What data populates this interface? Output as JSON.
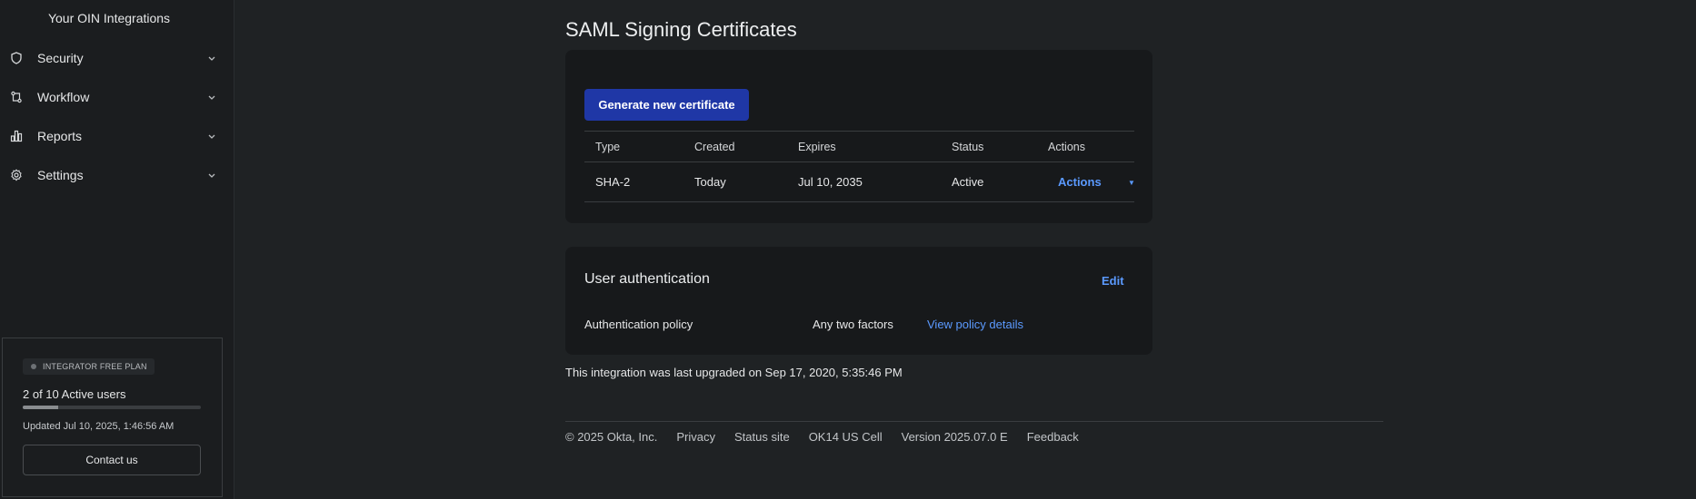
{
  "sidebar": {
    "top_link": "Your OIN Integrations",
    "items": [
      {
        "label": "Security",
        "icon": "shield-icon"
      },
      {
        "label": "Workflow",
        "icon": "workflow-icon"
      },
      {
        "label": "Reports",
        "icon": "chart-icon"
      },
      {
        "label": "Settings",
        "icon": "gear-icon"
      }
    ],
    "plan": {
      "badge": "INTEGRATOR FREE PLAN",
      "users_text": "2 of 10 Active users",
      "users_fraction": 0.2,
      "updated": "Updated Jul 10, 2025, 1:46:56 AM",
      "contact_label": "Contact us"
    }
  },
  "main": {
    "page_title": "SAML Signing Certificates",
    "generate_label": "Generate new certificate",
    "table": {
      "headers": [
        "Type",
        "Created",
        "Expires",
        "Status",
        "Actions"
      ],
      "rows": [
        {
          "type": "SHA-2",
          "created": "Today",
          "expires": "Jul 10, 2035",
          "status": "Active",
          "actions": "Actions"
        }
      ]
    },
    "auth": {
      "title": "User authentication",
      "edit_label": "Edit",
      "policy_label": "Authentication policy",
      "policy_value": "Any two factors",
      "policy_link": "View policy details"
    },
    "upgraded_text": "This integration was last upgraded on Sep 17, 2020, 5:35:46 PM"
  },
  "footer": {
    "copyright": "© 2025 Okta, Inc.",
    "links": [
      "Privacy",
      "Status site"
    ],
    "cell": "OK14 US Cell",
    "version": "Version 2025.07.0 E",
    "feedback": "Feedback"
  },
  "colors": {
    "background": "#1f2224",
    "sidebar": "#1b1d1f",
    "card": "#17191b",
    "primary_button": "#1f37a6",
    "link": "#5b9aff"
  }
}
